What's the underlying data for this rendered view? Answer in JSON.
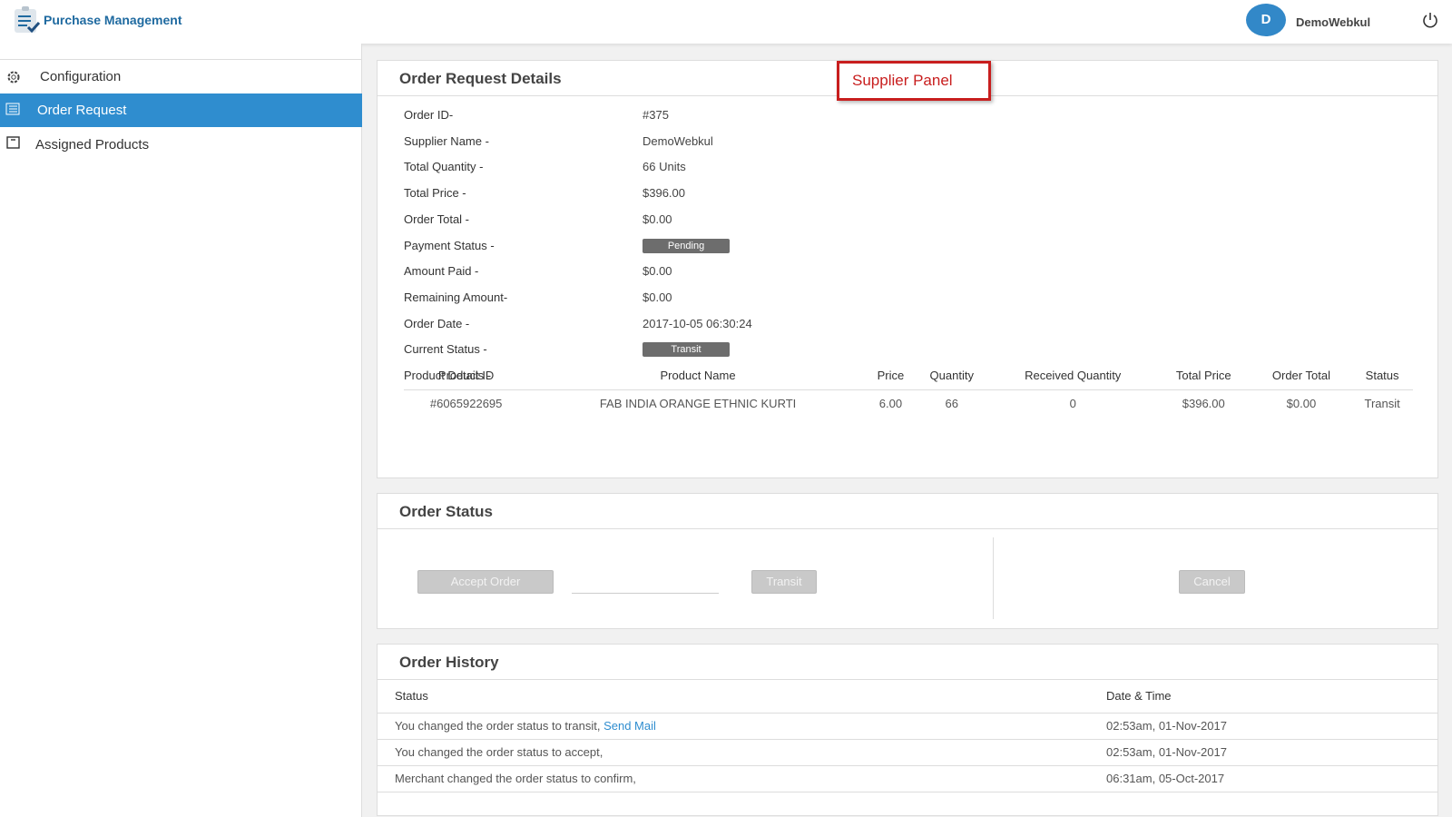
{
  "header": {
    "brand": "Purchase Management",
    "avatar_initial": "D",
    "username": "DemoWebkul"
  },
  "sidebar": {
    "items": [
      {
        "label": "Configuration"
      },
      {
        "label": "Order Request"
      },
      {
        "label": "Assigned Products"
      }
    ]
  },
  "details": {
    "title": "Order Request Details",
    "annotation": "Supplier Panel",
    "fields": [
      {
        "label": "Order ID-",
        "value": "#375"
      },
      {
        "label": "Supplier Name -",
        "value": "DemoWebkul"
      },
      {
        "label": "Total Quantity -",
        "value": "66 Units"
      },
      {
        "label": "Total Price -",
        "value": "$396.00"
      },
      {
        "label": "Order Total -",
        "value": "$0.00"
      },
      {
        "label": "Payment Status -",
        "value": "Pending"
      },
      {
        "label": "Amount Paid -",
        "value": "$0.00"
      },
      {
        "label": "Remaining Amount-",
        "value": "$0.00"
      },
      {
        "label": "Order Date -",
        "value": "2017-10-05 06:30:24"
      },
      {
        "label": "Current Status -",
        "value": "Transit"
      },
      {
        "label": "Product Details -",
        "value": ""
      }
    ],
    "columns": [
      "Product ID",
      "Product Name",
      "Price",
      "Quantity",
      "Received Quantity",
      "Total Price",
      "Order Total",
      "Status"
    ],
    "rows": [
      [
        "#6065922695",
        "FAB INDIA ORANGE ETHNIC KURTI",
        "6.00",
        "66",
        "0",
        "$396.00",
        "$0.00",
        "Transit"
      ]
    ]
  },
  "status": {
    "title": "Order Status",
    "accept": "Accept Order",
    "transit": "Transit",
    "cancel": "Cancel"
  },
  "history": {
    "title": "Order History",
    "col_status": "Status",
    "col_date": "Date & Time",
    "rows": [
      {
        "status": "You changed the order status to transit,",
        "link": "Send Mail",
        "date": "02:53am, 01-Nov-2017"
      },
      {
        "status": "You changed the order status to accept,",
        "link": "",
        "date": "02:53am, 01-Nov-2017"
      },
      {
        "status": "Merchant changed the order status to confirm,",
        "link": "",
        "date": "06:31am, 05-Oct-2017"
      }
    ]
  }
}
